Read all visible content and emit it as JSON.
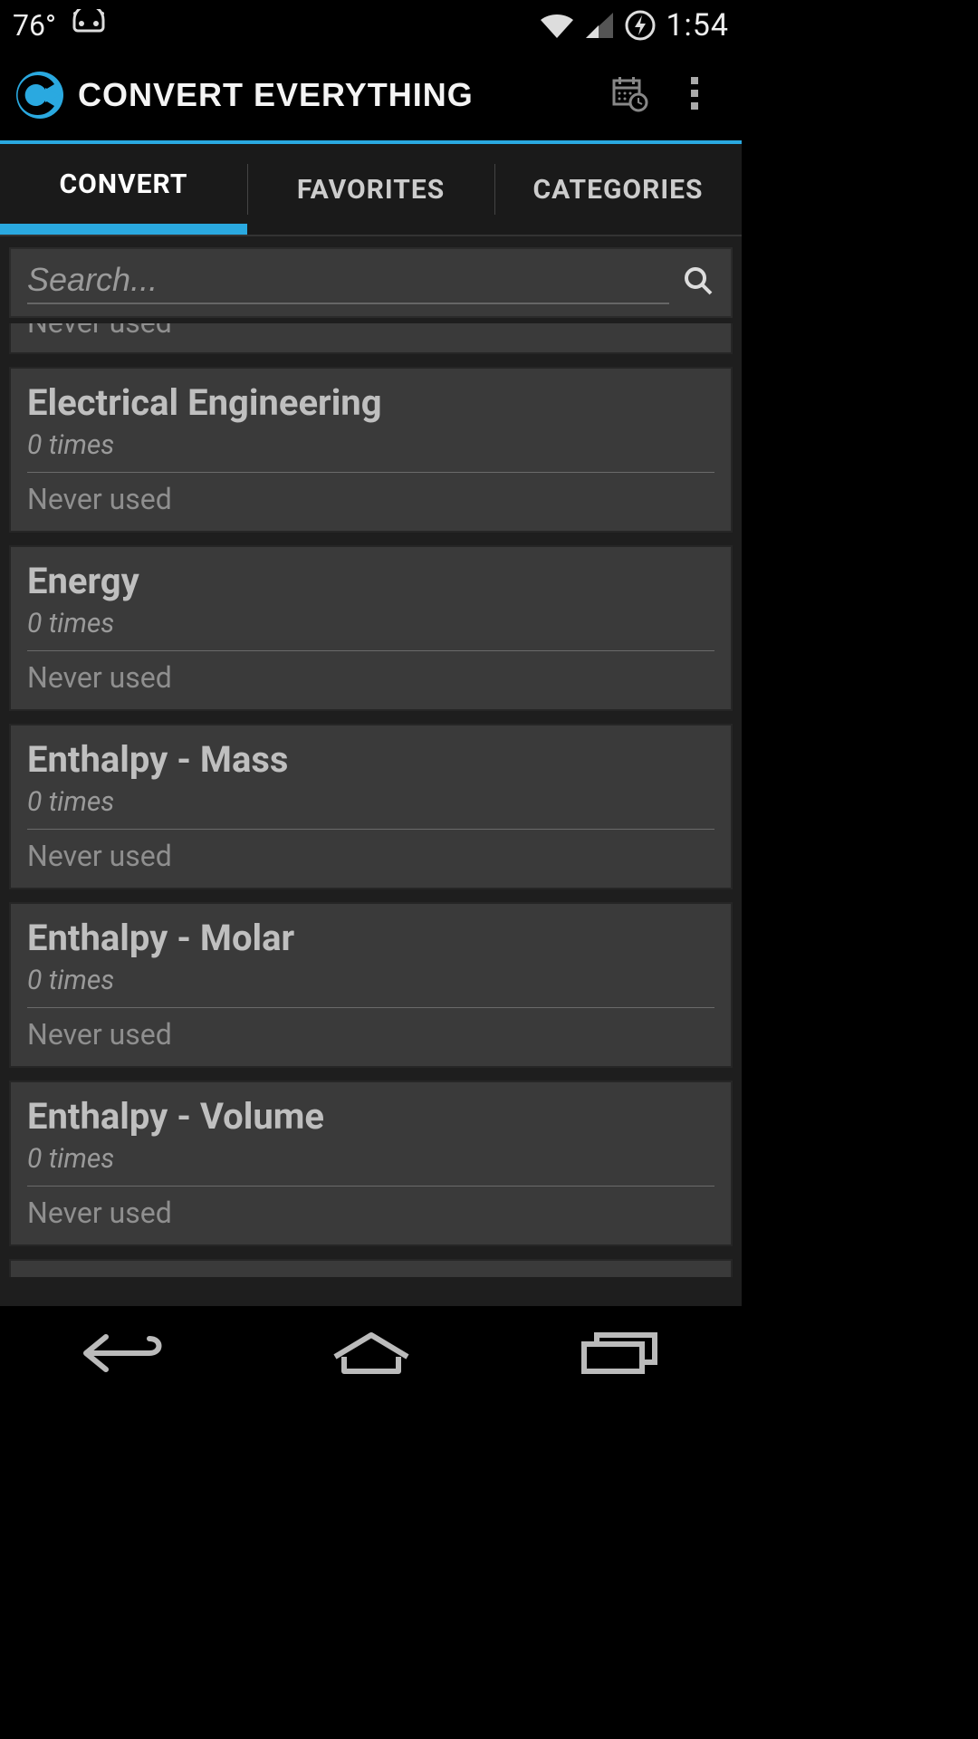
{
  "status": {
    "temp": "76°",
    "clock": "1:54"
  },
  "header": {
    "title": "CONVERT EVERYTHING"
  },
  "tabs": {
    "items": [
      {
        "label": "CONVERT",
        "active": true
      },
      {
        "label": "FAVORITES",
        "active": false
      },
      {
        "label": "CATEGORIES",
        "active": false
      }
    ]
  },
  "search": {
    "placeholder": "Search...",
    "value": ""
  },
  "list": {
    "cut_top_last_used": "Never used",
    "items": [
      {
        "title": "Electrical Engineering",
        "times": "0 times",
        "last_used": "Never used"
      },
      {
        "title": "Energy",
        "times": "0 times",
        "last_used": "Never used"
      },
      {
        "title": "Enthalpy - Mass",
        "times": "0 times",
        "last_used": "Never used"
      },
      {
        "title": "Enthalpy - Molar",
        "times": "0 times",
        "last_used": "Never used"
      },
      {
        "title": "Enthalpy - Volume",
        "times": "0 times",
        "last_used": "Never used"
      }
    ]
  }
}
